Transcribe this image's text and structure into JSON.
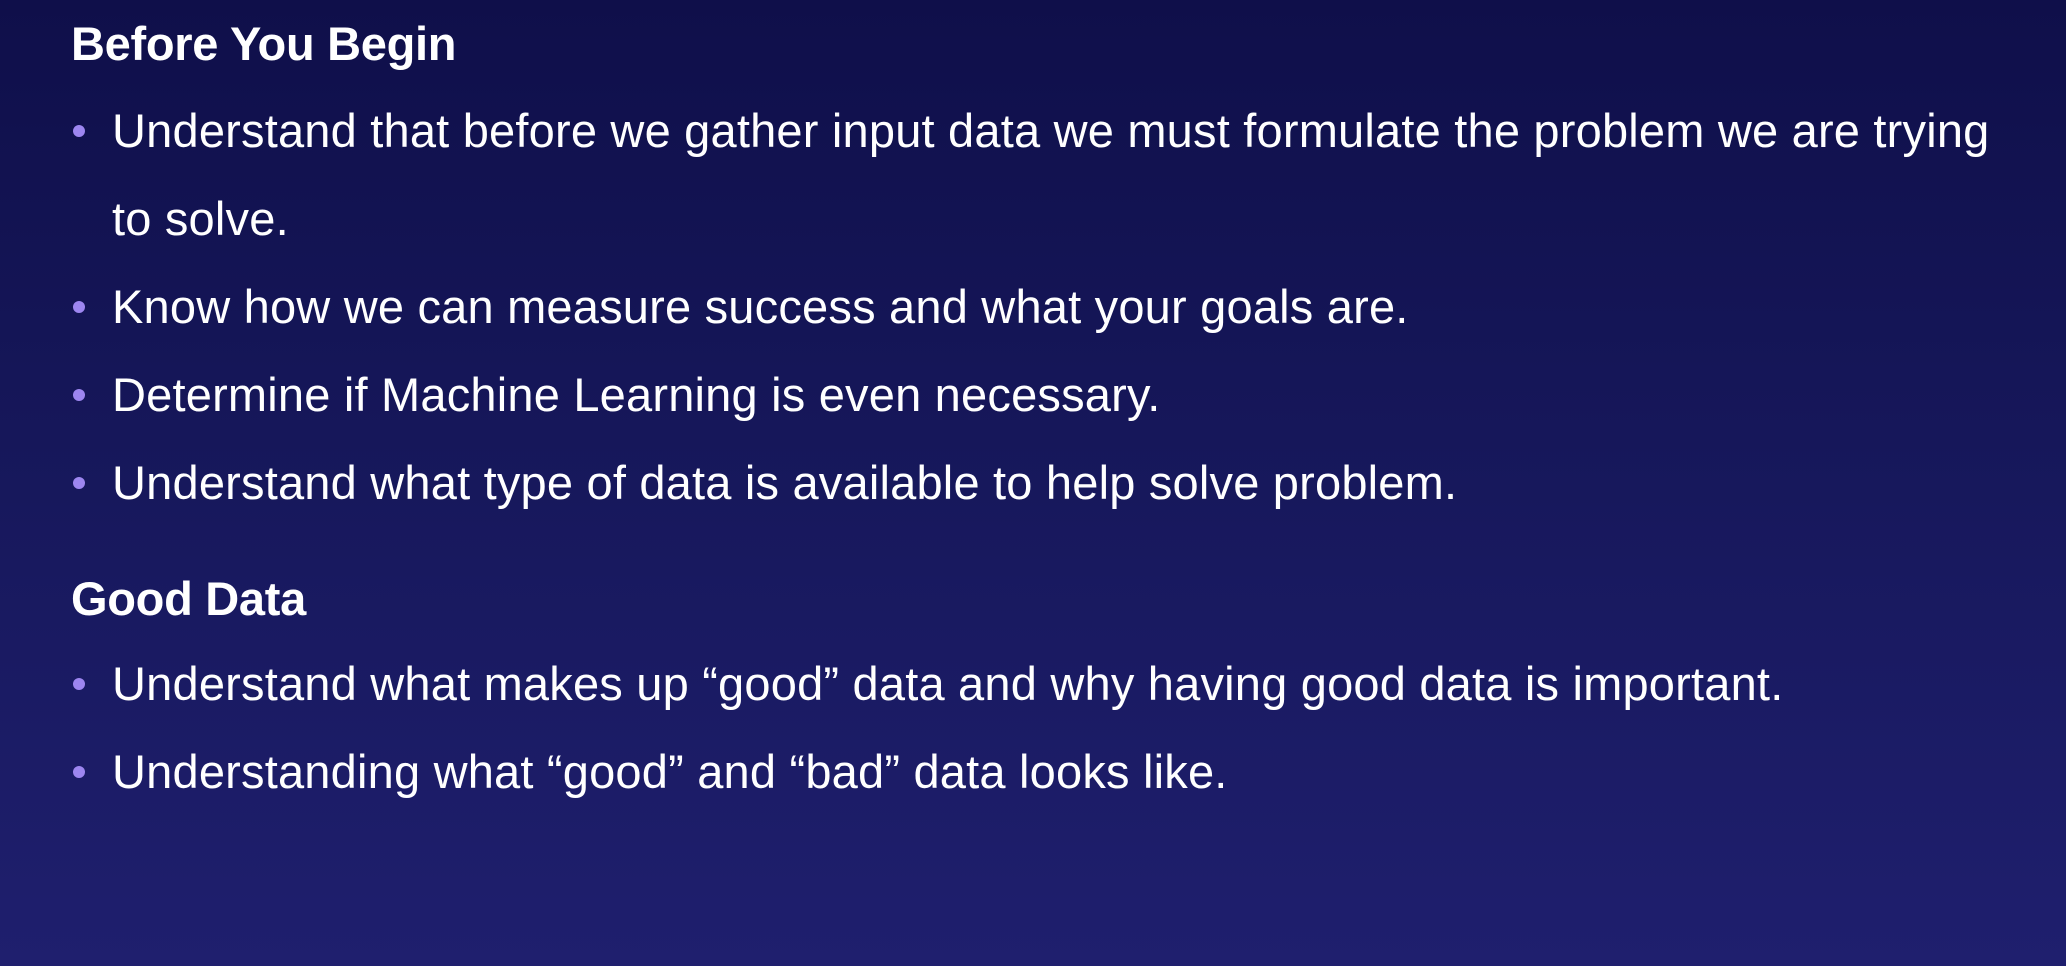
{
  "sections": [
    {
      "title": "Before You Begin",
      "bullets": [
        "Understand that before we gather input data we must formulate the problem we are trying to solve.",
        "Know how we can measure success and what your goals are.",
        "Determine if Machine Learning is even necessary.",
        "Understand what type of data is available to help solve problem."
      ]
    },
    {
      "title": "Good Data",
      "bullets": [
        "Understand what makes up “good” data and why having good data is important.",
        "Understanding what “good” and “bad” data looks like."
      ]
    }
  ],
  "colors": {
    "background_top": "#0f0f4a",
    "background_bottom": "#1f1f6e",
    "bullet_dot": "#9d86f0",
    "text": "#ffffff"
  }
}
